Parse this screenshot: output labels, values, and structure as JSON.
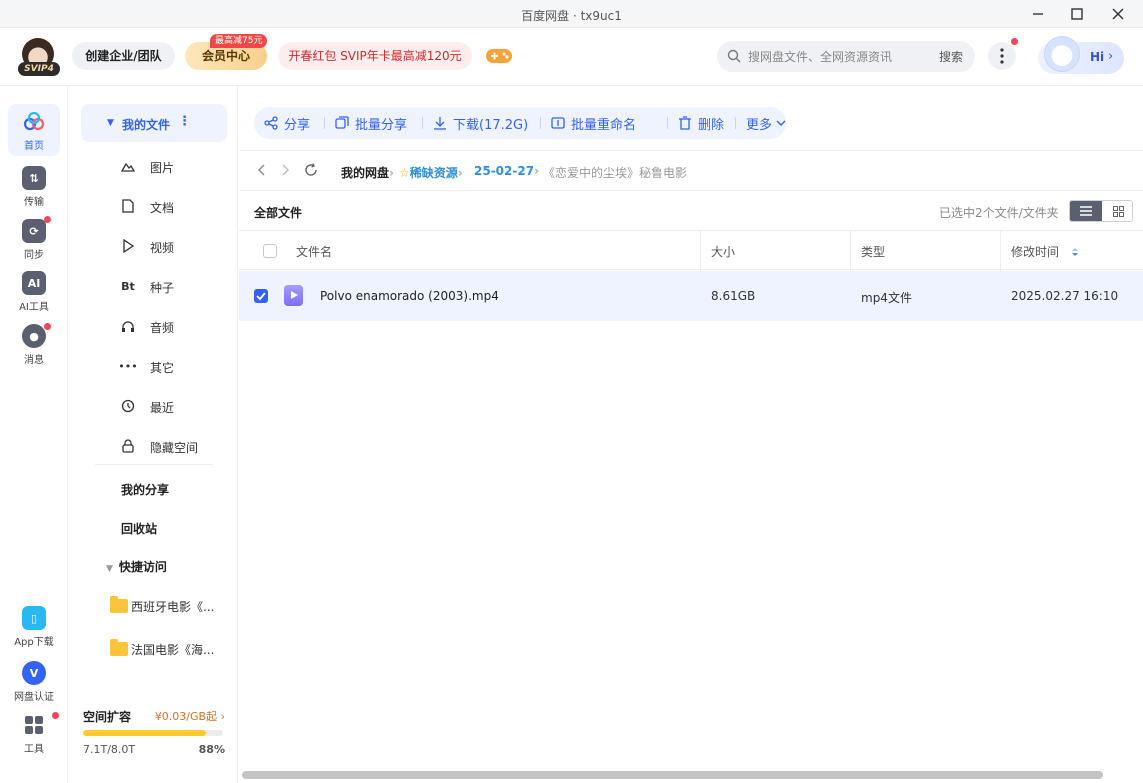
{
  "window": {
    "title": "百度网盘 · tx9uc1"
  },
  "header": {
    "avatar_badge": "SVIP4",
    "team_label": "创建企业/团队",
    "vip_label": "会员中心",
    "vip_tag": "最高减75元",
    "promo_label": "开春红包 SVIP年卡最高减120元",
    "search_placeholder": "搜网盘文件、全网资源资讯",
    "search_button": "搜索",
    "assistant_label": "Hi"
  },
  "rail": {
    "items": [
      {
        "label": "首页",
        "icon": "cloud-home-icon"
      },
      {
        "label": "传输",
        "icon": "transfer-icon"
      },
      {
        "label": "同步",
        "icon": "sync-icon"
      },
      {
        "label": "AI工具",
        "icon": "ai-tools-icon"
      },
      {
        "label": "消息",
        "icon": "message-icon"
      }
    ],
    "bottom_items": [
      {
        "label": "App下载",
        "icon": "app-download-icon"
      },
      {
        "label": "网盘认证",
        "icon": "verify-icon"
      },
      {
        "label": "工具",
        "icon": "tools-icon"
      }
    ]
  },
  "sidebar": {
    "my_files": "我的文件",
    "categories": [
      {
        "label": "图片",
        "icon": "image-icon"
      },
      {
        "label": "文档",
        "icon": "document-icon"
      },
      {
        "label": "视频",
        "icon": "video-icon"
      },
      {
        "label": "种子",
        "icon": "torrent-icon",
        "glyph": "Bt"
      },
      {
        "label": "音频",
        "icon": "audio-icon"
      },
      {
        "label": "其它",
        "icon": "other-icon"
      },
      {
        "label": "最近",
        "icon": "recent-icon"
      },
      {
        "label": "隐藏空间",
        "icon": "lock-icon"
      }
    ],
    "my_share": "我的分享",
    "recycle_bin": "回收站",
    "quick_access": "快捷访问",
    "quick_folders": [
      "西班牙电影《...",
      "法国电影《海..."
    ],
    "storage": {
      "title": "空间扩容",
      "price": "¥0.03/GB起",
      "used": "7.1T/8.0T",
      "percent_label": "88%",
      "percent": 88
    }
  },
  "toolbar": {
    "share": "分享",
    "batch_share": "批量分享",
    "download": "下载(17.2G)",
    "batch_rename": "批量重命名",
    "delete": "删除",
    "more": "更多"
  },
  "breadcrumb": {
    "root": "我的网盘",
    "items": [
      "稀缺资源",
      "25-02-27",
      "《恋爱中的尘埃》秘鲁电影"
    ]
  },
  "file_list": {
    "title": "全部文件",
    "selection_info": "已选中2个文件/文件夹",
    "columns": {
      "name": "文件名",
      "size": "大小",
      "type": "类型",
      "modified": "修改时间"
    },
    "rows": [
      {
        "name": "Polvo enamorado (2003).mp4",
        "size": "8.61GB",
        "type": "mp4文件",
        "modified": "2025.02.27 16:10",
        "selected": true
      }
    ]
  },
  "colors": {
    "accent": "#3363f2",
    "selection_bg": "#eef3ff",
    "folder": "#fcc43a",
    "badge_red": "#f5445a"
  }
}
